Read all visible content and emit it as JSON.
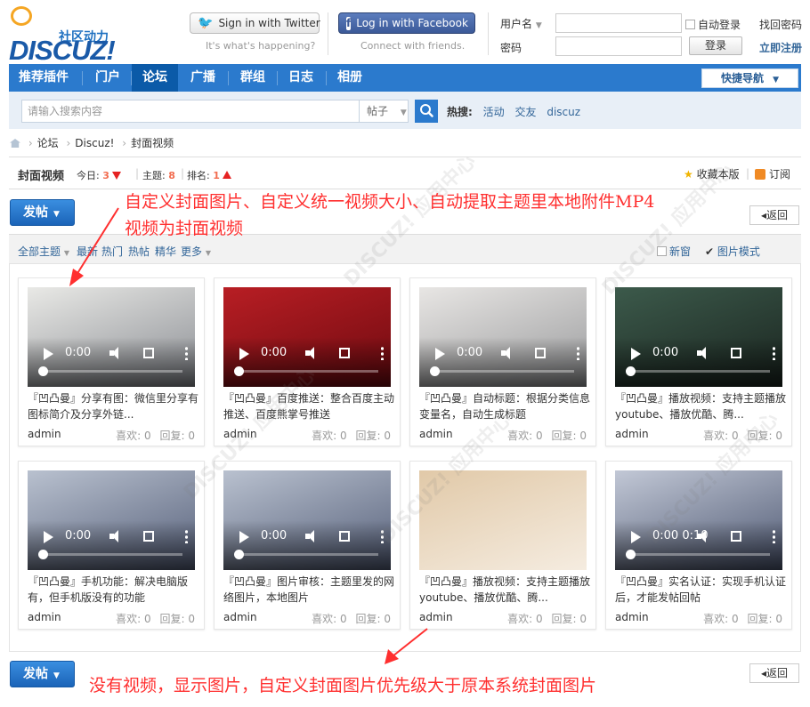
{
  "logo": {
    "sub": "社区动力",
    "main": "DISCUZ!"
  },
  "social": {
    "twitter_label": "Sign in with Twitter",
    "twitter_caption": "It's what's happening?",
    "facebook_label": "Log in with Facebook",
    "facebook_caption": "Connect with friends."
  },
  "login": {
    "username_label": "用户名",
    "password_label": "密码",
    "auto_login": "自动登录",
    "forgot": "找回密码",
    "login_button": "登录",
    "register": "立即注册"
  },
  "nav": {
    "items": [
      "推荐插件",
      "门户",
      "论坛",
      "广播",
      "群组",
      "日志",
      "相册"
    ],
    "active_index": 2,
    "quick_nav": "快捷导航"
  },
  "search": {
    "placeholder": "请输入搜索内容",
    "type": "帖子",
    "hot_label": "热搜:",
    "hot_terms": [
      "活动",
      "交友",
      "discuz"
    ]
  },
  "breadcrumb": [
    "论坛",
    "Discuz!",
    "封面视频"
  ],
  "forum": {
    "title": "封面视频",
    "today_label": "今日:",
    "today": "3",
    "topics_label": "主题:",
    "topics": "8",
    "rank_label": "排名:",
    "rank": "1",
    "favorite": "收藏本版",
    "subscribe": "订阅"
  },
  "post_button": "发帖",
  "back_button": "返回",
  "filters": {
    "all": "全部主题",
    "items": [
      "最新",
      "热门",
      "热帖",
      "精华",
      "更多"
    ],
    "new_window": "新窗",
    "image_mode": "图片模式"
  },
  "cards": [
    {
      "title": "『凹凸曼』分享有图：微信里分享有图标简介及分享外链...",
      "author": "admin",
      "likes": "喜欢: 0",
      "replies": "回复: 0",
      "time": "0:00",
      "colors": [
        "#e9e9e6",
        "#8a8d93"
      ]
    },
    {
      "title": "『凹凸曼』百度推送：整合百度主动推送、百度熊掌号推送",
      "author": "admin",
      "likes": "喜欢: 0",
      "replies": "回复: 0",
      "time": "0:00",
      "colors": [
        "#b81e24",
        "#6e0a10"
      ]
    },
    {
      "title": "『凹凸曼』自动标题：根据分类信息变量名，自动生成标题",
      "author": "admin",
      "likes": "喜欢: 0",
      "replies": "回复: 0",
      "time": "0:00",
      "colors": [
        "#e8e6e4",
        "#999a9c"
      ]
    },
    {
      "title": "『凹凸曼』播放视频：支持主题播放youtube、播放优酷、腾...",
      "author": "admin",
      "likes": "喜欢: 0",
      "replies": "回复: 0",
      "time": "0:00",
      "colors": [
        "#3c5a4b",
        "#1a241f"
      ]
    },
    {
      "title": "『凹凸曼』手机功能：解决电脑版有，但手机版没有的功能",
      "author": "admin",
      "likes": "喜欢: 0",
      "replies": "回复: 0",
      "time": "0:00",
      "colors": [
        "#b9c1cf",
        "#56607a"
      ]
    },
    {
      "title": "『凹凸曼』图片审核：主题里发的网络图片，本地图片",
      "author": "admin",
      "likes": "喜欢: 0",
      "replies": "回复: 0",
      "time": "0:00",
      "colors": [
        "#b9c1cf",
        "#56607a"
      ]
    },
    {
      "title": "『凹凸曼』播放视频：支持主题播放youtube、播放优酷、腾...",
      "author": "admin",
      "likes": "喜欢: 0",
      "replies": "回复: 0",
      "time": "",
      "colors": [
        "#e1c9a8",
        "#f5ece0"
      ]
    },
    {
      "title": "『凹凸曼』实名认证：实现手机认证后，才能发帖回帖",
      "author": "admin",
      "likes": "喜欢: 0",
      "replies": "回复: 0",
      "time": "0:00 0:10",
      "colors": [
        "#c2c8d6",
        "#4e5872"
      ]
    }
  ],
  "annotations": {
    "top_line1": "自定义封面图片、自定义统一视频大小、自动提取主题里本地附件MP4",
    "top_line2": "视频为封面视频",
    "bottom": "没有视频，显示图片，自定义封面图片优先级大于原本系统封面图片"
  },
  "colors": {
    "nav": "#2b7acd",
    "nav_active": "#0b5aa8",
    "accent_red": "#ff2f2f",
    "link": "#336699"
  }
}
